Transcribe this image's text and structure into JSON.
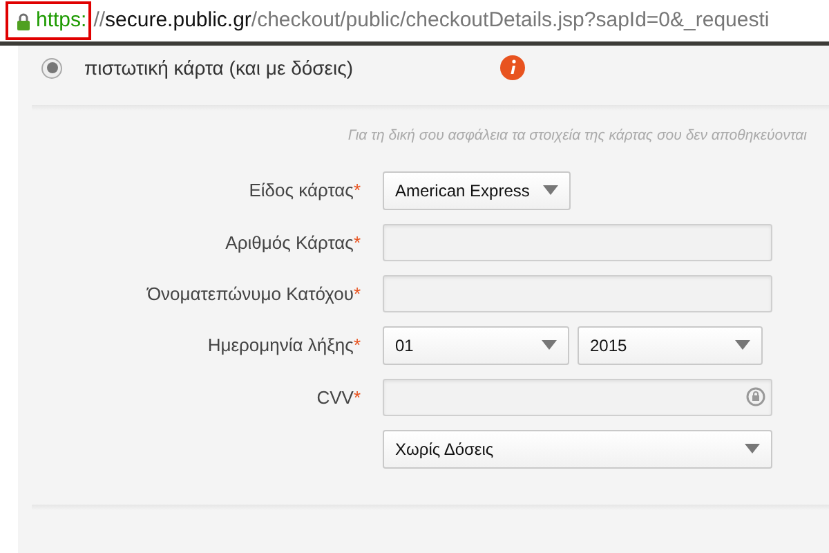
{
  "address_bar": {
    "scheme": "https:",
    "separator": "//",
    "host": "secure.public.gr",
    "path": "/checkout/public/checkoutDetails.jsp?sapId=0&_requesti"
  },
  "payment_option": {
    "label": "πιστωτική κάρτα (και με δόσεις)",
    "selected": true
  },
  "security_note": "Για τη δική σου ασφάλεια τα στοιχεία της κάρτας σου δεν αποθηκεύονται",
  "fields": [
    {
      "kind": "select",
      "label": "Είδος κάρτας",
      "required_mark": "*",
      "value": "American Express"
    },
    {
      "kind": "input",
      "label": "Αριθμός Κάρτας",
      "required_mark": "*"
    },
    {
      "kind": "input",
      "label": "Όνοματεπώνυμο Κατόχου",
      "required_mark": "*"
    },
    {
      "kind": "date",
      "label": "Ημερομηνία λήξης",
      "required_mark": "*",
      "month": "01",
      "year": "2015"
    },
    {
      "kind": "cvv",
      "label": "CVV",
      "required_mark": "*"
    },
    {
      "kind": "wide-select",
      "value": "Χωρίς Δόσεις"
    }
  ]
}
